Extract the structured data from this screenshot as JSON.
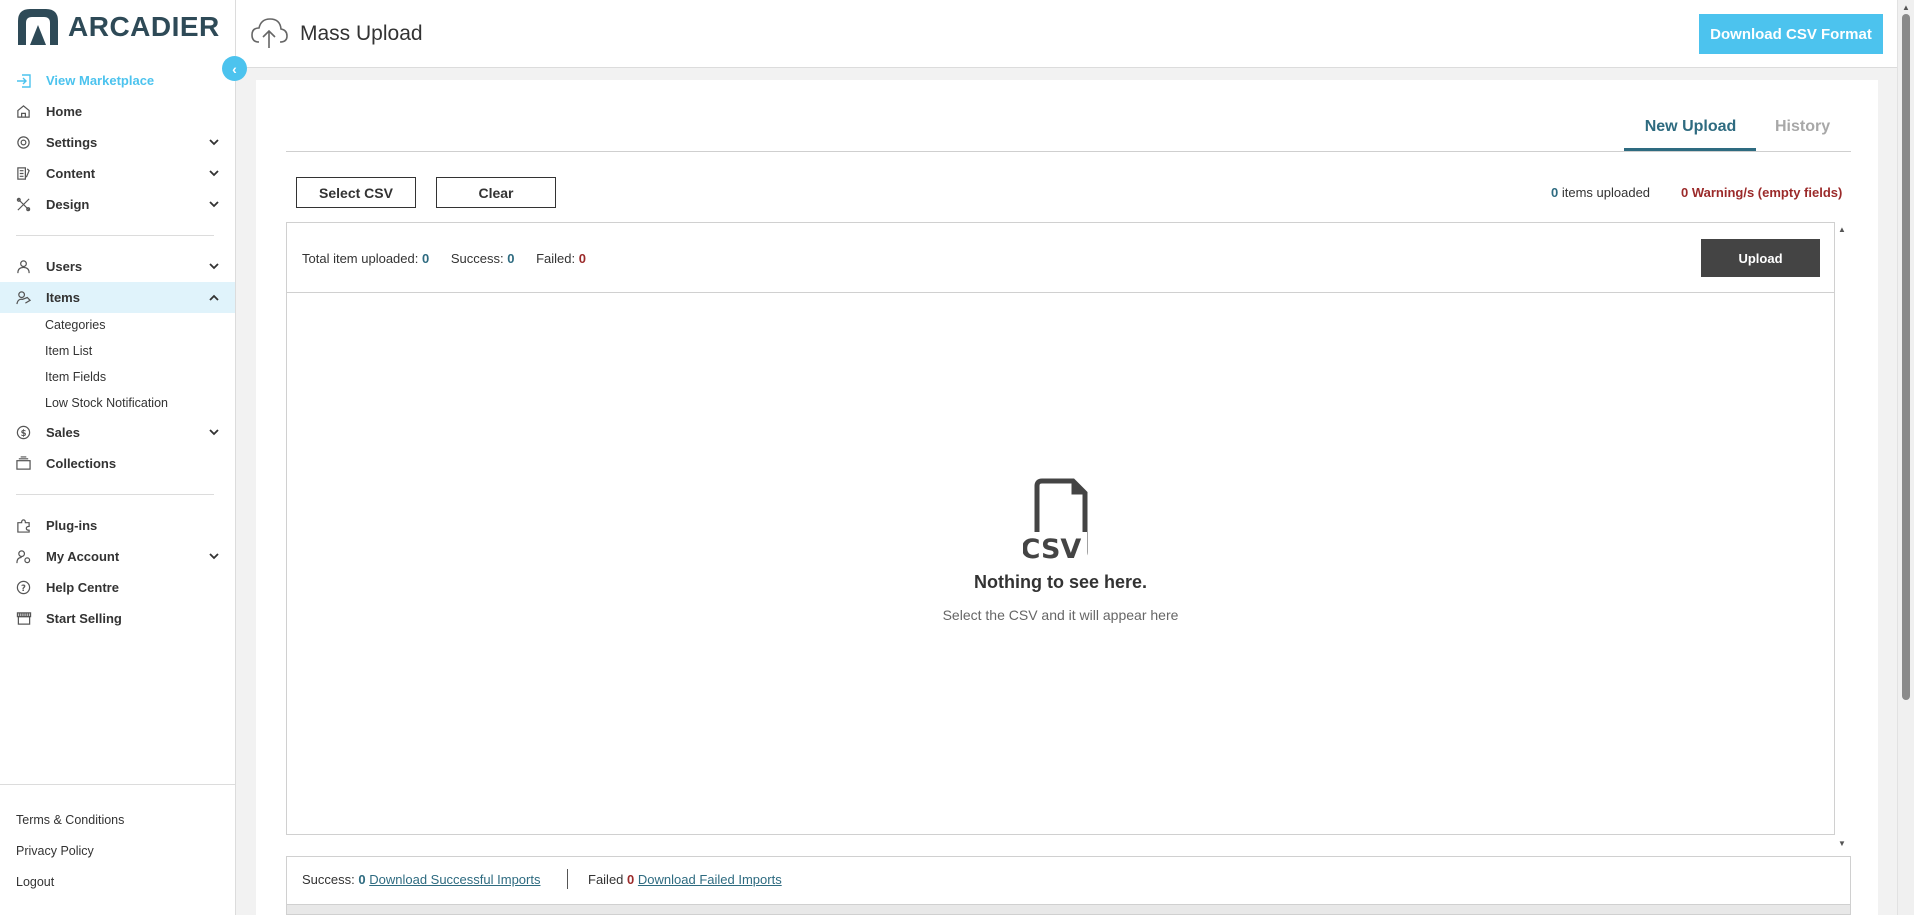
{
  "brand": {
    "name": "ARCADIER",
    "color": "#2e4a57",
    "accent": "#4cc3ee"
  },
  "sidebar": {
    "items": [
      {
        "label": "View Marketplace",
        "icon": "enter-icon"
      },
      {
        "label": "Home",
        "icon": "home-icon"
      },
      {
        "label": "Settings",
        "icon": "gear-icon"
      },
      {
        "label": "Content",
        "icon": "content-icon"
      },
      {
        "label": "Design",
        "icon": "design-icon"
      },
      {
        "label": "Users",
        "icon": "user-icon"
      },
      {
        "label": "Items",
        "icon": "items-icon"
      },
      {
        "label": "Sales",
        "icon": "dollar-icon"
      },
      {
        "label": "Collections",
        "icon": "collections-icon"
      },
      {
        "label": "Plug-ins",
        "icon": "puzzle-icon"
      },
      {
        "label": "My Account",
        "icon": "account-icon"
      },
      {
        "label": "Help Centre",
        "icon": "help-icon"
      },
      {
        "label": "Start Selling",
        "icon": "store-icon"
      }
    ],
    "items_sub": [
      "Categories",
      "Item List",
      "Item Fields",
      "Low Stock Notification"
    ],
    "footer": [
      "Terms & Conditions",
      "Privacy Policy",
      "Logout"
    ]
  },
  "header": {
    "title": "Mass Upload",
    "download_format_label": "Download CSV Format"
  },
  "tabs": {
    "new_upload": "New Upload",
    "history": "History"
  },
  "toolbar": {
    "select_csv": "Select CSV",
    "clear": "Clear",
    "items_uploaded_count": "0",
    "items_uploaded_label": "items uploaded",
    "warnings": "0 Warning/s (empty fields)"
  },
  "upload_box": {
    "total_label": "Total item uploaded:",
    "total_value": "0",
    "success_label": "Success:",
    "success_value": "0",
    "failed_label": "Failed:",
    "failed_value": "0",
    "upload_button": "Upload",
    "empty_title": "Nothing to see here.",
    "empty_subtitle": "Select the CSV and it will appear here",
    "csv_icon_text": "CSV"
  },
  "bottom": {
    "success_label": "Success:",
    "success_value": "0",
    "download_success": "Download Successful Imports",
    "failed_label": "Failed",
    "failed_value": "0",
    "download_failed": "Download Failed Imports"
  }
}
